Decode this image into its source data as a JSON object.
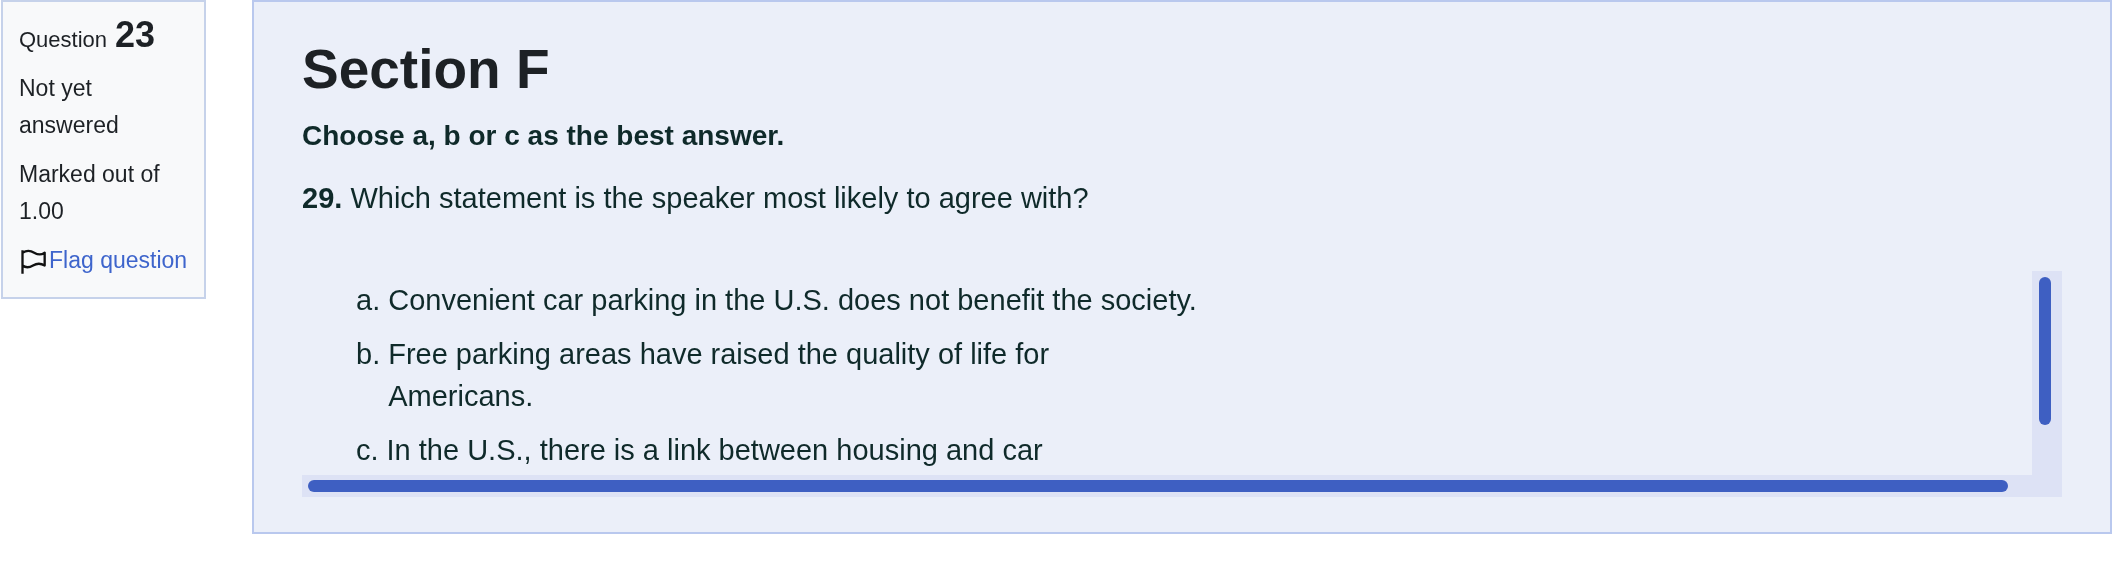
{
  "info": {
    "label": "Question",
    "number": "23",
    "status": "Not yet answered",
    "marks": "Marked out of 1.00",
    "flag_link": "Flag question",
    "flagged": false
  },
  "question": {
    "section_title": "Section F",
    "instruction": "Choose a, b or c as the best answer.",
    "number": "29.",
    "text": "Which statement is the speaker most likely to agree with?",
    "options": [
      {
        "letter": "a.",
        "text": "Convenient car parking in the U.S. does not benefit the society."
      },
      {
        "letter": "b.",
        "text": "Free parking areas have raised the quality of life for Americans."
      },
      {
        "letter": "c.",
        "text": "In the U.S., there is a link between housing and car"
      }
    ]
  }
}
